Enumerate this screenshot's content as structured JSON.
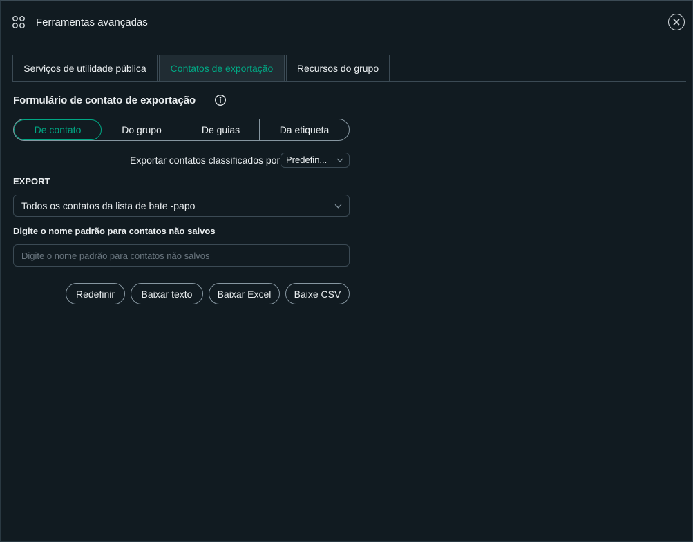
{
  "window": {
    "title": "Ferramentas avançadas",
    "icon": "apps-grid-icon",
    "close_icon": "close-icon"
  },
  "tabs": [
    {
      "label": "Serviços de utilidade pública",
      "active": false
    },
    {
      "label": "Contatos de exportação",
      "active": true
    },
    {
      "label": "Recursos do grupo",
      "active": false
    }
  ],
  "form": {
    "title": "Formulário de contato de exportação",
    "info_icon": "info-icon",
    "segments": [
      {
        "label": "De contato",
        "active": true
      },
      {
        "label": "Do grupo",
        "active": false
      },
      {
        "label": "De guias",
        "active": false
      },
      {
        "label": "Da etiqueta",
        "active": false
      }
    ],
    "sort_label": "Exportar contatos classificados por",
    "sort_value": "Predefin...",
    "export_label": "EXPORT",
    "export_value": "Todos os contatos da lista de bate -papo",
    "default_name_label": "Digite o nome padrão para contatos não salvos",
    "default_name_placeholder": "Digite o nome padrão para contatos não salvos",
    "default_name_value": ""
  },
  "actions": {
    "reset": "Redefinir",
    "download_text": "Baixar texto",
    "download_excel": "Baixar Excel",
    "download_csv": "Baixe CSV"
  },
  "colors": {
    "background": "#111b21",
    "accent": "#00a884",
    "border": "#3b4a54",
    "text": "#e9edef"
  }
}
